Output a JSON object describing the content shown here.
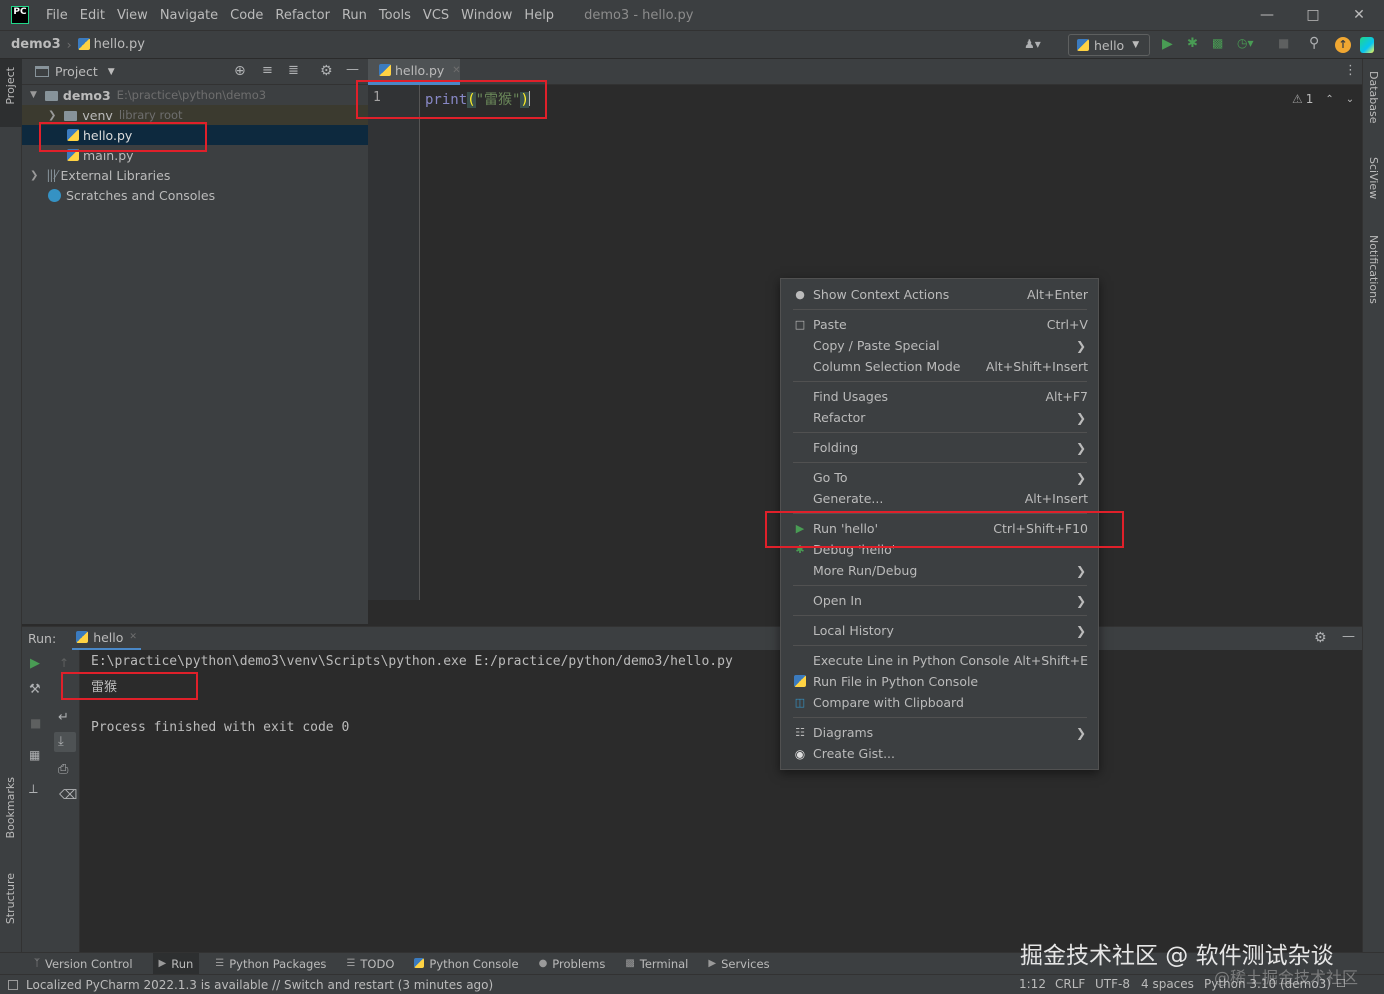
{
  "titlebar": {
    "logo": "PC",
    "menu": [
      "File",
      "Edit",
      "View",
      "Navigate",
      "Code",
      "Refactor",
      "Run",
      "Tools",
      "VCS",
      "Window",
      "Help"
    ],
    "title": "demo3 - hello.py",
    "controls": [
      "minimize-icon",
      "maximize-icon",
      "close-icon"
    ]
  },
  "navbar": {
    "project": "demo3",
    "file": "hello.py",
    "run_config": "hello"
  },
  "left_strip": {
    "project": "Project",
    "bookmarks": "Bookmarks",
    "structure": "Structure"
  },
  "right_strip": {
    "database": "Database",
    "sciview": "SciView",
    "notifications": "Notifications"
  },
  "project_panel": {
    "title": "Project",
    "tree": [
      {
        "label": "demo3",
        "hint": "E:\\practice\\python\\demo3"
      },
      {
        "label": "venv",
        "hint": "library root"
      },
      {
        "label": "hello.py",
        "hint": ""
      },
      {
        "label": "main.py",
        "hint": ""
      },
      {
        "label": "External Libraries",
        "hint": ""
      },
      {
        "label": "Scratches and Consoles",
        "hint": ""
      }
    ]
  },
  "editor": {
    "tab": "hello.py",
    "line_number": "1",
    "code_func": "print",
    "code_open": "(",
    "code_string": "\"雷猴\"",
    "code_close": ")",
    "warnings": "1"
  },
  "run_panel": {
    "label": "Run:",
    "tab": "hello",
    "lines": [
      "E:\\practice\\python\\demo3\\venv\\Scripts\\python.exe E:/practice/python/demo3/hello.py",
      "雷猴",
      "Process finished with exit code 0"
    ]
  },
  "context_menu": {
    "items": [
      {
        "label": "Show Context Actions",
        "shortcut": "Alt+Enter"
      },
      {
        "label": "Paste",
        "shortcut": "Ctrl+V"
      },
      {
        "label": "Copy / Paste Special",
        "shortcut": ""
      },
      {
        "label": "Column Selection Mode",
        "shortcut": "Alt+Shift+Insert"
      },
      {
        "label": "Find Usages",
        "shortcut": "Alt+F7"
      },
      {
        "label": "Refactor",
        "shortcut": ""
      },
      {
        "label": "Folding",
        "shortcut": ""
      },
      {
        "label": "Go To",
        "shortcut": ""
      },
      {
        "label": "Generate...",
        "shortcut": "Alt+Insert"
      },
      {
        "label": "Run 'hello'",
        "shortcut": "Ctrl+Shift+F10"
      },
      {
        "label": "Debug 'hello'",
        "shortcut": ""
      },
      {
        "label": "More Run/Debug",
        "shortcut": ""
      },
      {
        "label": "Open In",
        "shortcut": ""
      },
      {
        "label": "Local History",
        "shortcut": ""
      },
      {
        "label": "Execute Line in Python Console",
        "shortcut": "Alt+Shift+E"
      },
      {
        "label": "Run File in Python Console",
        "shortcut": ""
      },
      {
        "label": "Compare with Clipboard",
        "shortcut": ""
      },
      {
        "label": "Diagrams",
        "shortcut": ""
      },
      {
        "label": "Create Gist...",
        "shortcut": ""
      }
    ]
  },
  "bottom_tabs": [
    "Version Control",
    "Run",
    "Python Packages",
    "TODO",
    "Python Console",
    "Problems",
    "Terminal",
    "Services"
  ],
  "statusbar": {
    "message": "Localized PyCharm 2022.1.3 is available // Switch and restart (3 minutes ago)",
    "position": "1:12",
    "line_sep": "CRLF",
    "encoding": "UTF-8",
    "indent": "4 spaces",
    "interpreter": "Python 3.10 (demo3)"
  },
  "watermark": {
    "main": "掘金技术社区 @ 软件测试杂谈",
    "sub": "@稀土掘金技术社区"
  },
  "colors": {
    "accent_red_box": "#e0202a",
    "selection": "#0d293e",
    "run_green": "#499c54",
    "keyword": "#8888c6",
    "string": "#6a8759"
  }
}
